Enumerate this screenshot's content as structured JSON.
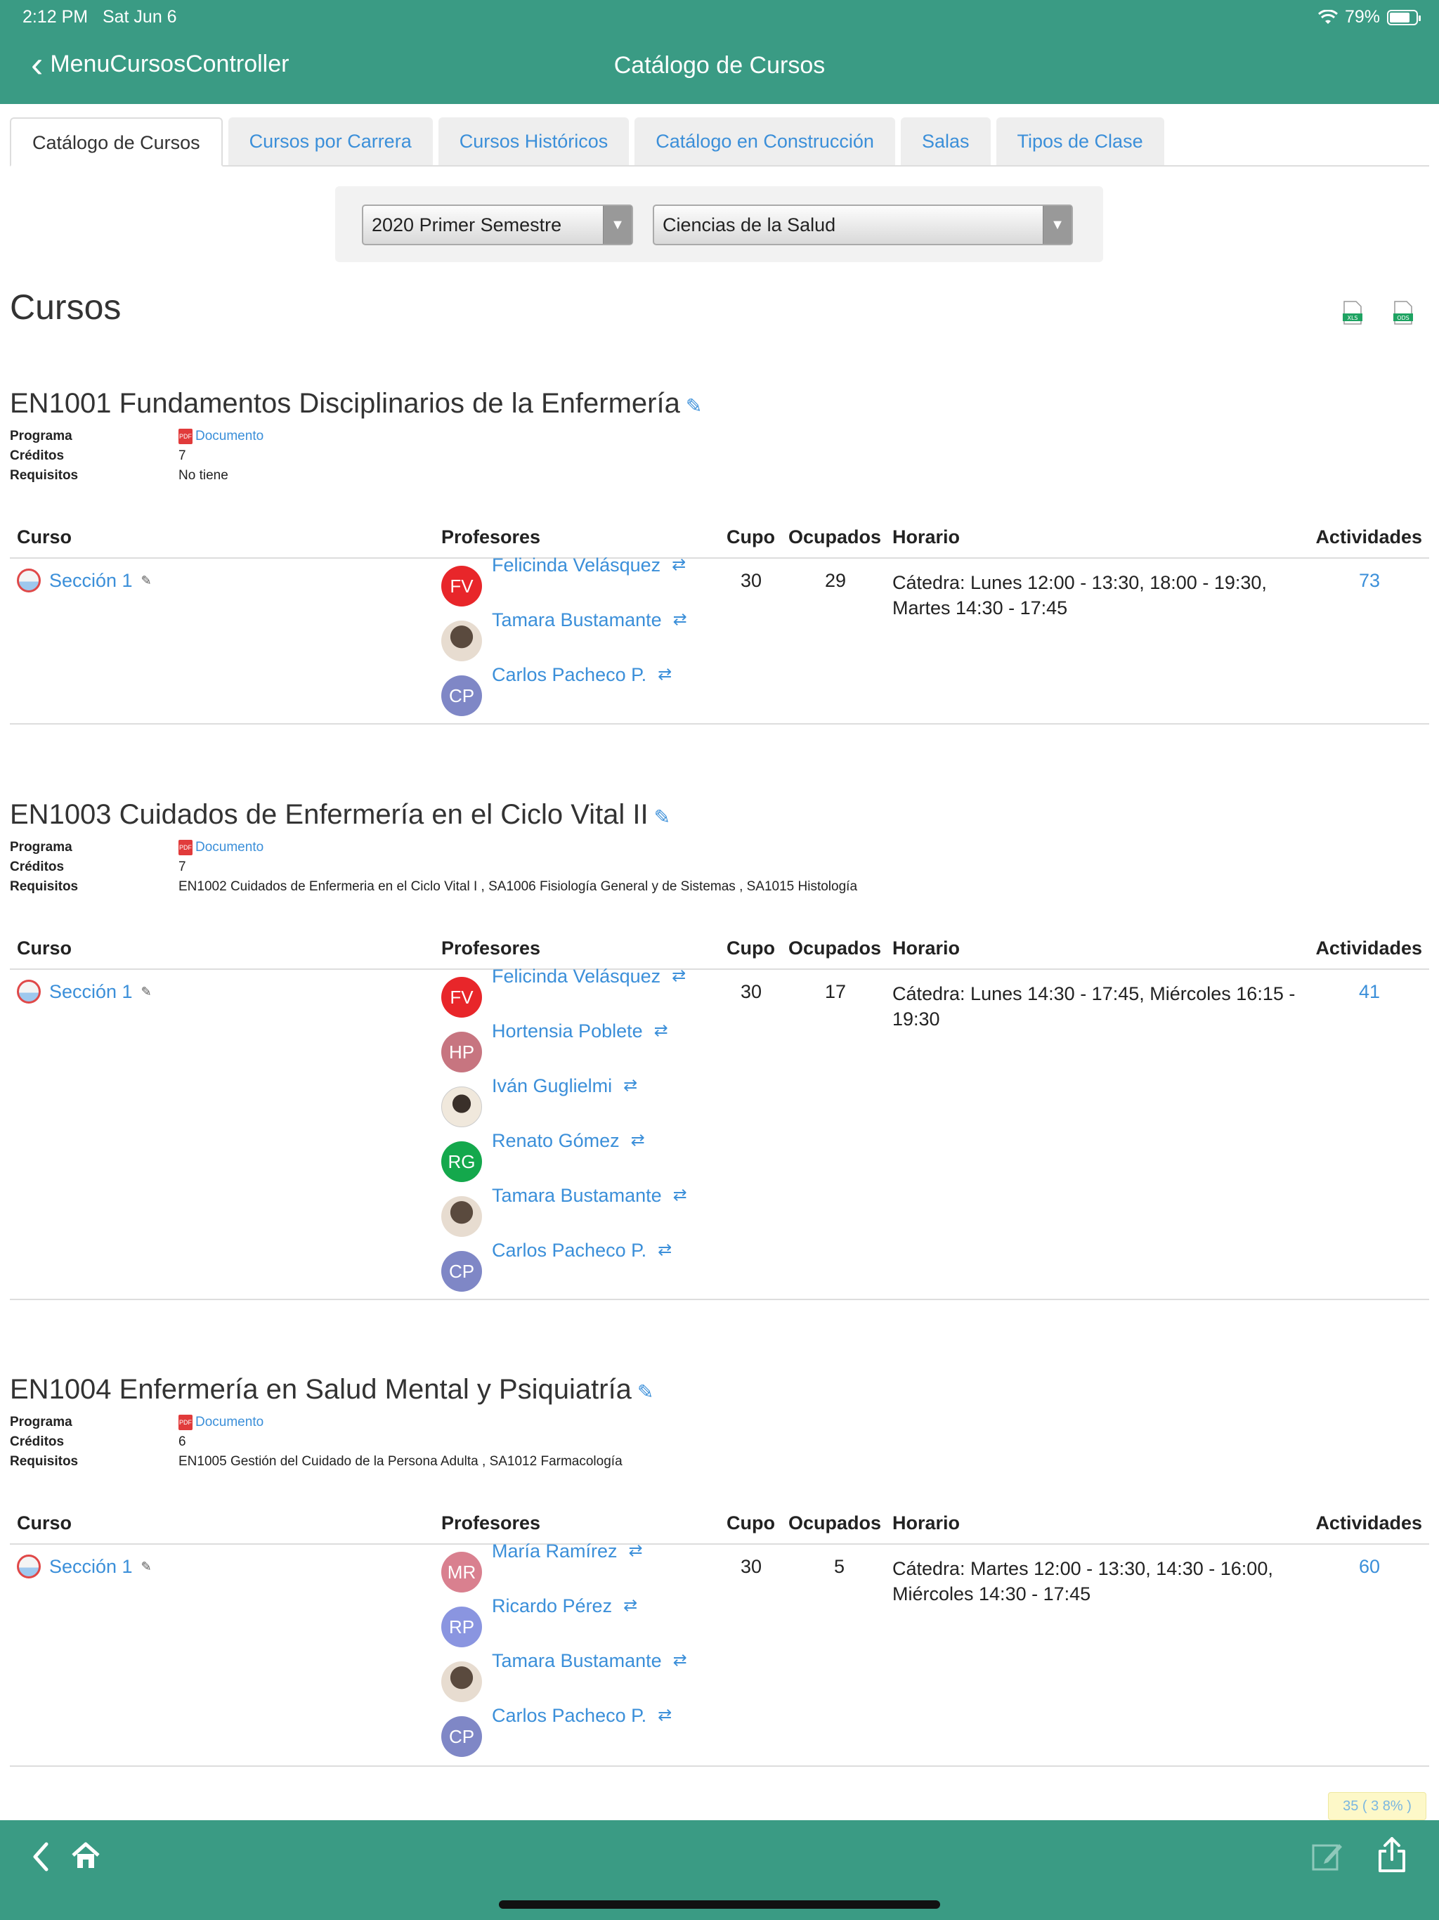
{
  "status_bar": {
    "time": "2:12 PM",
    "date": "Sat Jun 6",
    "battery": "79%"
  },
  "nav": {
    "back_label": "MenuCursosController",
    "title": "Catálogo de Cursos"
  },
  "tabs": [
    {
      "label": "Catálogo de Cursos",
      "active": true
    },
    {
      "label": "Cursos por Carrera"
    },
    {
      "label": "Cursos Históricos"
    },
    {
      "label": "Catálogo en Construcción"
    },
    {
      "label": "Salas"
    },
    {
      "label": "Tipos de Clase"
    }
  ],
  "filters": {
    "semester": "2020 Primer Semestre",
    "area": "Ciencias de la Salud"
  },
  "page": {
    "heading": "Cursos",
    "export_xls": "XLS",
    "export_ods": "ODS",
    "badge": "35 ( 3  8% )"
  },
  "labels": {
    "programa": "Programa",
    "creditos": "Créditos",
    "requisitos": "Requisitos",
    "documento": "Documento",
    "pdf": "PDF",
    "col_curso": "Curso",
    "col_profesores": "Profesores",
    "col_cupo": "Cupo",
    "col_ocupados": "Ocupados",
    "col_horario": "Horario",
    "col_actividades": "Actividades",
    "swap": "⇄",
    "pencil": "✎",
    "mini_pencil": "✎"
  },
  "courses": [
    {
      "title": "EN1001 Fundamentos Disciplinarios de la Enfermería",
      "creditos": "7",
      "requisitos": "No tiene",
      "seccion": "Sección 1",
      "cupo": "30",
      "ocupados": "29",
      "horario": "Cátedra: Lunes 12:00 - 13:30, 18:00 - 19:30, Martes 14:30 - 17:45",
      "actividades": "73",
      "profesores": [
        {
          "initials": "FV",
          "name": "Felicinda Velásquez",
          "color": "#e8262a"
        },
        {
          "initials": "",
          "name": "Tamara Bustamante",
          "photo": true
        },
        {
          "initials": "CP",
          "name": "Carlos Pacheco P.",
          "color": "#7f87c6"
        }
      ]
    },
    {
      "title": "EN1003 Cuidados de Enfermería en el Ciclo Vital II",
      "creditos": "7",
      "requisitos": "EN1002 Cuidados de Enfermeria en el Ciclo Vital I , SA1006 Fisiología General y de Sistemas , SA1015 Histología",
      "seccion": "Sección 1",
      "cupo": "30",
      "ocupados": "17",
      "horario": "Cátedra: Lunes 14:30 - 17:45, Miércoles 16:15 - 19:30",
      "actividades": "41",
      "profesores": [
        {
          "initials": "FV",
          "name": "Felicinda Velásquez",
          "color": "#e8262a"
        },
        {
          "initials": "HP",
          "name": "Hortensia Poblete",
          "color": "#c77580"
        },
        {
          "initials": "",
          "name": "Iván Guglielmi",
          "photo": true
        },
        {
          "initials": "RG",
          "name": "Renato Gómez",
          "color": "#14a84c"
        },
        {
          "initials": "",
          "name": "Tamara Bustamante",
          "photo": true
        },
        {
          "initials": "CP",
          "name": "Carlos Pacheco P.",
          "color": "#7f87c6"
        }
      ]
    },
    {
      "title": "EN1004 Enfermería en Salud Mental y Psiquiatría",
      "creditos": "6",
      "requisitos": "EN1005 Gestión del Cuidado de la Persona Adulta , SA1012 Farmacología",
      "seccion": "Sección 1",
      "cupo": "30",
      "ocupados": "5",
      "horario": "Cátedra: Martes 12:00 - 13:30, 14:30 - 16:00, Miércoles 14:30 - 17:45",
      "actividades": "60",
      "profesores": [
        {
          "initials": "MR",
          "name": "María Ramírez",
          "color": "#d9808f"
        },
        {
          "initials": "RP",
          "name": "Ricardo Pérez",
          "color": "#8a95e0"
        },
        {
          "initials": "",
          "name": "Tamara Bustamante",
          "photo": true
        },
        {
          "initials": "CP",
          "name": "Carlos Pacheco P.",
          "color": "#7f87c6"
        }
      ]
    }
  ],
  "toolbar": {
    "back_icon": "chevron-left-icon",
    "home_icon": "home-icon",
    "compose_icon": "compose-icon",
    "share_icon": "share-icon"
  }
}
